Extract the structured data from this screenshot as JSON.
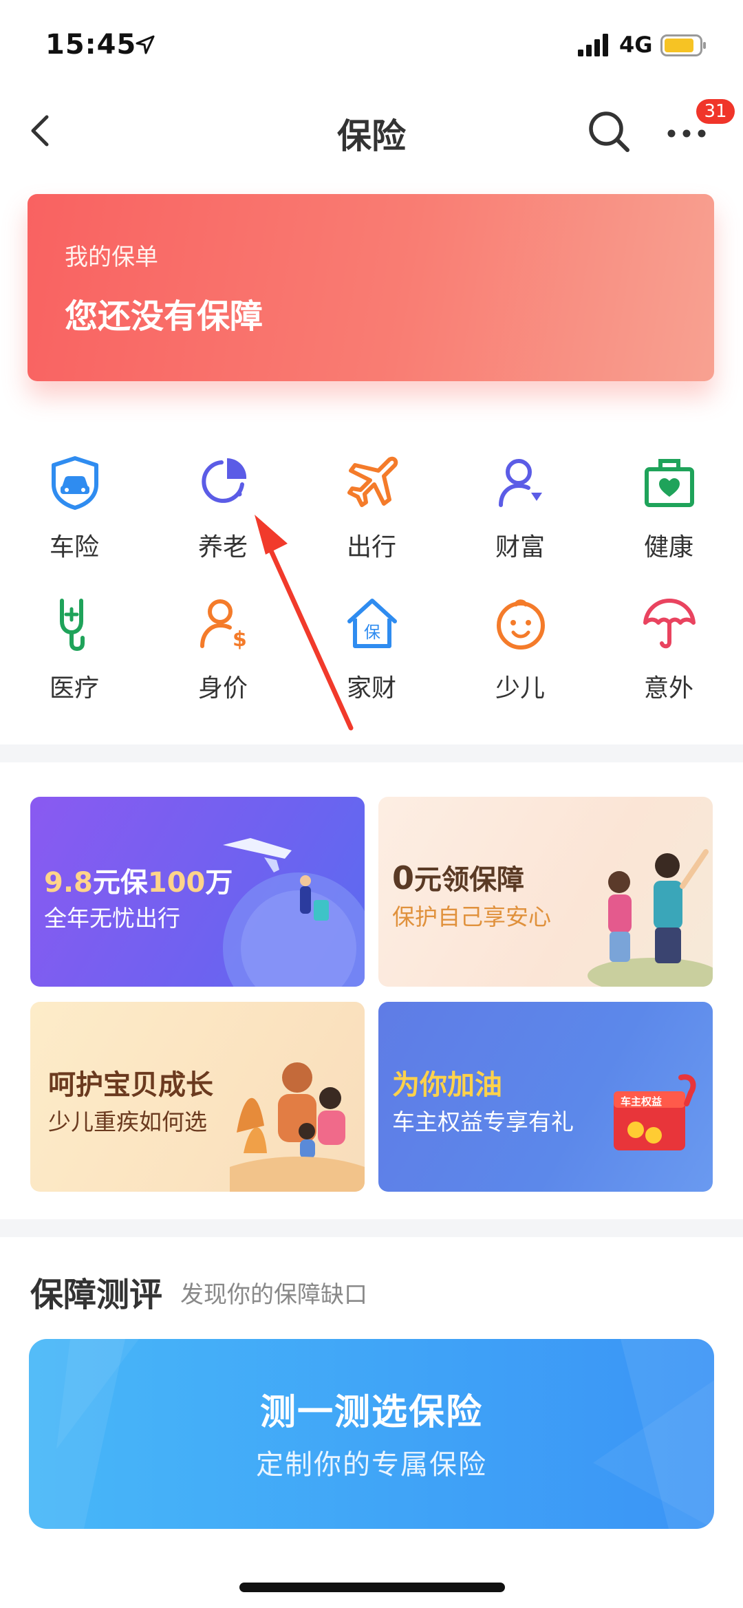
{
  "status_bar": {
    "time": "15:45",
    "network": "4G"
  },
  "nav": {
    "title": "保险",
    "badge_count": "31"
  },
  "policy_card": {
    "label": "我的保单",
    "status": "您还没有保障"
  },
  "categories": [
    {
      "label": "车险",
      "icon": "car-shield-icon"
    },
    {
      "label": "养老",
      "icon": "pie-chart-icon"
    },
    {
      "label": "出行",
      "icon": "airplane-icon"
    },
    {
      "label": "财富",
      "icon": "person-diamond-icon"
    },
    {
      "label": "健康",
      "icon": "briefcase-heart-icon"
    },
    {
      "label": "医疗",
      "icon": "stethoscope-icon"
    },
    {
      "label": "身价",
      "icon": "person-dollar-icon"
    },
    {
      "label": "家财",
      "icon": "house-icon"
    },
    {
      "label": "少儿",
      "icon": "baby-face-icon"
    },
    {
      "label": "意外",
      "icon": "umbrella-icon"
    }
  ],
  "promos": [
    {
      "title_a": "9.8",
      "title_b": "元保",
      "title_c": "100",
      "title_d": "万",
      "subtitle": "全年无忧出行"
    },
    {
      "title_a": "0",
      "title_b": "元领保障",
      "subtitle": "保护自己享安心"
    },
    {
      "title": "呵护宝贝成长",
      "subtitle": "少儿重疾如何选"
    },
    {
      "title": "为你加油",
      "subtitle": "车主权益专享有礼",
      "tag": "车主权益"
    }
  ],
  "assessment": {
    "title": "保障测评",
    "subtitle": "发现你的保障缺口",
    "banner_title": "测一测选保险",
    "banner_subtitle": "定制你的专属保险"
  },
  "colors": {
    "accent_red": "#f96261",
    "badge_red": "#f0352a",
    "banner_blue": "#3fa2f7",
    "promo_purple": "#7a5cf0",
    "promo_blue": "#5c86e8"
  }
}
